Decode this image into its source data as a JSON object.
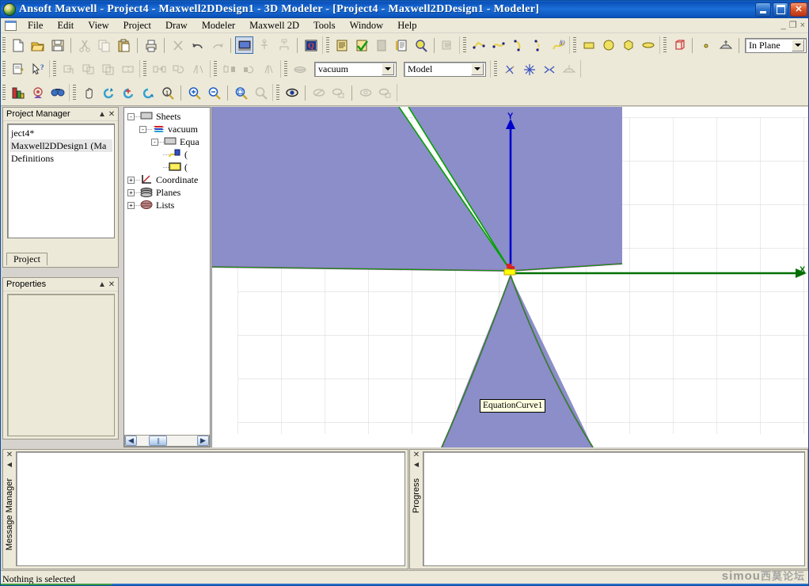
{
  "window": {
    "title": "Ansoft Maxwell - Project4 - Maxwell2DDesign1 - 3D Modeler - [Project4 - Maxwell2DDesign1 - Modeler]",
    "app_icon": "ansoft-logo-icon",
    "buttons": {
      "minimize": "minimize-icon",
      "restore": "restore-icon",
      "close": "close-icon"
    },
    "mdi_buttons": {
      "minimize": "_",
      "restore": "❐",
      "close": "×"
    }
  },
  "menu": {
    "doc_icon": "document-icon",
    "items": [
      "File",
      "Edit",
      "View",
      "Project",
      "Draw",
      "Modeler",
      "Maxwell 2D",
      "Tools",
      "Window",
      "Help"
    ]
  },
  "toolbars": {
    "row1": [
      {
        "name": "new-file-icon",
        "group": 0
      },
      {
        "name": "open-file-icon",
        "group": 0
      },
      {
        "name": "save-icon",
        "group": 0
      },
      {
        "name": "cut-icon",
        "group": 1,
        "disabled": true
      },
      {
        "name": "copy-icon",
        "group": 1,
        "disabled": true
      },
      {
        "name": "paste-icon",
        "group": 1
      },
      {
        "name": "print-icon",
        "group": 2
      },
      {
        "name": "delete-icon",
        "group": 3,
        "disabled": true
      },
      {
        "name": "undo-icon",
        "group": 3
      },
      {
        "name": "redo-icon",
        "group": 3,
        "disabled": true
      },
      {
        "name": "analyze-all-icon",
        "group": 4,
        "pressed": true
      },
      {
        "name": "validation-check-icon",
        "group": 4,
        "disabled": true
      },
      {
        "name": "mesh-icon",
        "group": 4,
        "disabled": true
      },
      {
        "name": "solution-data-icon",
        "group": 5
      },
      {
        "name": "report-icon",
        "group": 6
      },
      {
        "name": "validate-icon",
        "group": 6
      },
      {
        "name": "clean-icon",
        "group": 6,
        "disabled": true
      },
      {
        "name": "design-settings-icon",
        "group": 6
      },
      {
        "name": "search-icon",
        "group": 6
      },
      {
        "name": "submit-job-icon",
        "group": 6,
        "disabled": true
      },
      {
        "name": "draw-line-icon",
        "group": 7
      },
      {
        "name": "draw-spline-icon",
        "group": 7
      },
      {
        "name": "draw-arc-center-icon",
        "group": 7
      },
      {
        "name": "draw-arc-3pt-icon",
        "group": 7
      },
      {
        "name": "draw-equation-curve-icon",
        "group": 7
      },
      {
        "name": "draw-rectangle-icon",
        "group": 8
      },
      {
        "name": "draw-circle-icon",
        "group": 8
      },
      {
        "name": "draw-regular-polygon-icon",
        "group": 8
      },
      {
        "name": "draw-ellipse-icon",
        "group": 8
      },
      {
        "name": "draw-box-icon",
        "group": 9
      },
      {
        "name": "draw-point-icon",
        "group": 10
      },
      {
        "name": "draw-plane-icon",
        "group": 10
      }
    ],
    "row1_combo": {
      "name": "draw-plane-select",
      "value": "In Plane"
    },
    "row2": [
      {
        "name": "help-context-icon",
        "group": 0
      },
      {
        "name": "whats-this-icon",
        "group": 0
      },
      {
        "name": "unite-icon",
        "group": 1,
        "disabled": true
      },
      {
        "name": "subtract-icon",
        "group": 1,
        "disabled": true
      },
      {
        "name": "intersect-icon",
        "group": 1,
        "disabled": true
      },
      {
        "name": "split-icon",
        "group": 1,
        "disabled": true
      },
      {
        "name": "move-icon",
        "group": 2,
        "disabled": true
      },
      {
        "name": "rotate-icon",
        "group": 2,
        "disabled": true
      },
      {
        "name": "mirror-icon",
        "group": 2,
        "disabled": true
      },
      {
        "name": "duplicate-move-icon",
        "group": 3,
        "disabled": true
      },
      {
        "name": "duplicate-rotate-icon",
        "group": 3,
        "disabled": true
      },
      {
        "name": "duplicate-mirror-icon",
        "group": 3,
        "disabled": true
      },
      {
        "name": "material-icon",
        "group": 4,
        "disabled": true
      }
    ],
    "row2_combos": [
      {
        "name": "material-select",
        "value": "vacuum"
      },
      {
        "name": "model-select",
        "value": "Model"
      }
    ],
    "row2_tail": [
      {
        "name": "move-face-icon",
        "group": 5
      },
      {
        "name": "move-free-icon",
        "group": 5
      },
      {
        "name": "move-along-icon",
        "group": 5
      },
      {
        "name": "measure-icon",
        "group": 5,
        "disabled": true
      }
    ],
    "row3": [
      {
        "name": "select-objects-icon",
        "group": 0
      },
      {
        "name": "select-faces-icon",
        "group": 0
      },
      {
        "name": "select-edges-icon",
        "group": 0
      },
      {
        "name": "pan-icon",
        "group": 1
      },
      {
        "name": "rotate-view-icon",
        "group": 1
      },
      {
        "name": "rotate-about-icon",
        "group": 1
      },
      {
        "name": "dynamic-rotate-icon",
        "group": 1
      },
      {
        "name": "spin-icon",
        "group": 1
      },
      {
        "name": "zoom-in-icon",
        "group": 2
      },
      {
        "name": "zoom-out-icon",
        "group": 2
      },
      {
        "name": "fit-all-icon",
        "group": 3
      },
      {
        "name": "fit-selection-icon",
        "group": 3,
        "disabled": true
      },
      {
        "name": "show-hidden-icon",
        "group": 4
      },
      {
        "name": "hide-objects-icon",
        "group": 4,
        "disabled": true
      },
      {
        "name": "hide-all-but-icon",
        "group": 4,
        "disabled": true
      },
      {
        "name": "show-objects-icon",
        "group": 5,
        "disabled": true
      },
      {
        "name": "show-all-icon",
        "group": 5,
        "disabled": true
      }
    ]
  },
  "project_manager": {
    "title": "Project Manager",
    "collapse_icon": "collapse-icon",
    "close_icon": "close-icon",
    "tree": [
      {
        "label": "ject4*",
        "selected": false
      },
      {
        "label": "Maxwell2DDesign1  (Ma",
        "selected": true
      },
      {
        "label": "Definitions",
        "selected": false
      }
    ],
    "scroll": {
      "left_icon": "chevron-left-icon",
      "right_icon": "chevron-right-icon"
    },
    "tab": "Project"
  },
  "properties": {
    "title": "Properties",
    "collapse_icon": "collapse-icon",
    "close_icon": "close-icon",
    "rows": []
  },
  "model_tree": {
    "items": [
      {
        "label": "Sheets",
        "icon": "sheet-folder-icon",
        "indent": 0,
        "expander": "-"
      },
      {
        "label": "vacuum",
        "icon": "material-stack-icon",
        "indent": 1,
        "expander": "-"
      },
      {
        "label": "Equa",
        "icon": "sheet-folder-icon",
        "indent": 2,
        "expander": "-"
      },
      {
        "label": "(",
        "icon": "equation-curve-icon",
        "indent": 3,
        "expander": ""
      },
      {
        "label": "(",
        "icon": "surface-icon",
        "indent": 3,
        "expander": ""
      },
      {
        "label": "Coordinate",
        "icon": "coordinate-systems-icon",
        "indent": 0,
        "expander": "+"
      },
      {
        "label": "Planes",
        "icon": "planes-icon",
        "indent": 0,
        "expander": "+"
      },
      {
        "label": "Lists",
        "icon": "lists-icon",
        "indent": 0,
        "expander": "+"
      }
    ],
    "scroll": {
      "left_icon": "chevron-left-icon",
      "right_icon": "chevron-right-icon"
    }
  },
  "model_view": {
    "object_label": "EquationCurve1",
    "axis_x_label": "X",
    "axis_y_label": "Y",
    "colors": {
      "face": "#8b8ec8",
      "edge_green": "#00a000",
      "edge_magenta": "#cc33cc",
      "axis_x": "#007000",
      "axis_y": "#0000cc",
      "grid": "#d8d8d8",
      "background": "#ffffff",
      "origin_marker": "#ffff00"
    },
    "grid_spacing_px": 55
  },
  "message_manager": {
    "title": "Message Manager",
    "close_icon": "close-icon",
    "pin_icon": "auto-hide-icon",
    "messages": []
  },
  "progress_panel": {
    "title": "Progress",
    "close_icon": "close-icon",
    "pin_icon": "auto-hide-icon",
    "entries": []
  },
  "status_bar": {
    "text": "Nothing is selected"
  },
  "watermark": {
    "latin": "simou",
    "chinese": "西莫论坛"
  }
}
